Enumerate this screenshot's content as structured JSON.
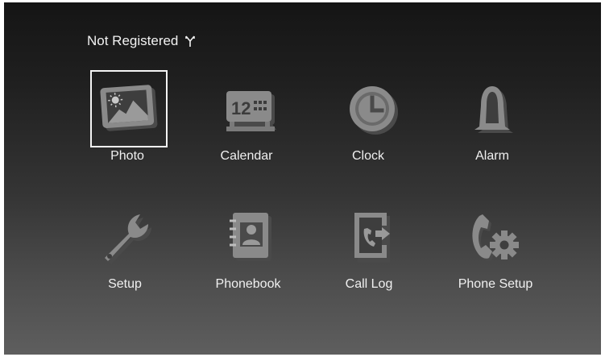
{
  "status": {
    "registration_text": "Not Registered",
    "signal_icon": "antenna-icon"
  },
  "menu": {
    "selected": "Photo",
    "items": [
      {
        "label": "Photo",
        "icon": "photo-icon"
      },
      {
        "label": "Calendar",
        "icon": "calendar-icon"
      },
      {
        "label": "Clock",
        "icon": "clock-icon"
      },
      {
        "label": "Alarm",
        "icon": "alarm-bell-icon"
      },
      {
        "label": "Setup",
        "icon": "wrench-icon"
      },
      {
        "label": "Phonebook",
        "icon": "phonebook-icon"
      },
      {
        "label": "Call Log",
        "icon": "call-log-icon"
      },
      {
        "label": "Phone Setup",
        "icon": "phone-gear-icon"
      }
    ],
    "calendar_icon_text": "12"
  },
  "colors": {
    "background_top": "#151515",
    "background_bottom": "#5e5e5e",
    "icon_face": "#8a8a8a",
    "icon_shadow": "#4a4a4a",
    "selection_border": "#f4f4f4",
    "text": "#f0f0f0"
  }
}
